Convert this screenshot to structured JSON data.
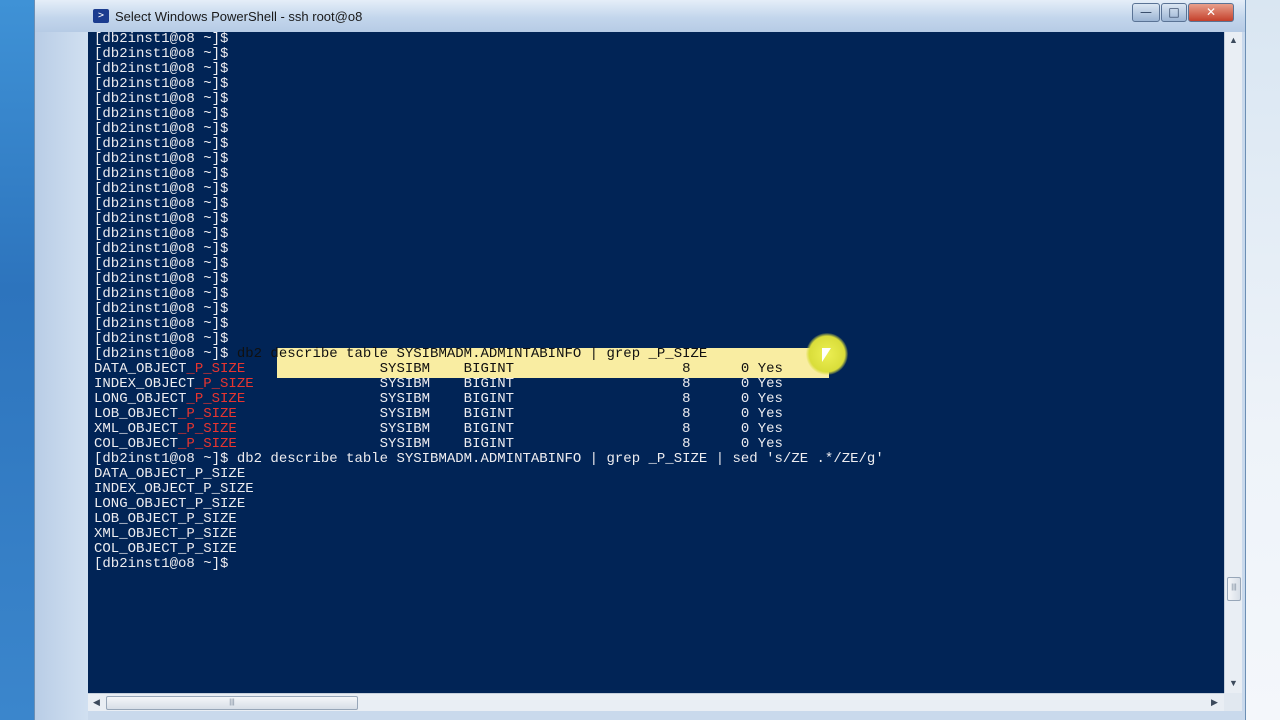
{
  "window": {
    "title": "Select Windows PowerShell - ssh  root@o8",
    "icon": "powershell-icon",
    "controls": {
      "minimize": "—",
      "maximize": "□",
      "close": "✕"
    }
  },
  "terminal": {
    "colors": {
      "background": "#012456",
      "text": "#eeedf0",
      "highlight": "#e8352f",
      "selection": "#f9eda2"
    },
    "lines": [
      [
        {
          "t": "[db2inst1@o8 ~]$"
        }
      ],
      [
        {
          "t": "[db2inst1@o8 ~]$"
        }
      ],
      [
        {
          "t": "[db2inst1@o8 ~]$"
        }
      ],
      [
        {
          "t": "[db2inst1@o8 ~]$"
        }
      ],
      [
        {
          "t": "[db2inst1@o8 ~]$"
        }
      ],
      [
        {
          "t": "[db2inst1@o8 ~]$"
        }
      ],
      [
        {
          "t": "[db2inst1@o8 ~]$"
        }
      ],
      [
        {
          "t": "[db2inst1@o8 ~]$"
        }
      ],
      [
        {
          "t": "[db2inst1@o8 ~]$"
        }
      ],
      [
        {
          "t": "[db2inst1@o8 ~]$"
        }
      ],
      [
        {
          "t": "[db2inst1@o8 ~]$"
        }
      ],
      [
        {
          "t": "[db2inst1@o8 ~]$"
        }
      ],
      [
        {
          "t": "[db2inst1@o8 ~]$"
        }
      ],
      [
        {
          "t": "[db2inst1@o8 ~]$"
        }
      ],
      [
        {
          "t": "[db2inst1@o8 ~]$"
        }
      ],
      [
        {
          "t": "[db2inst1@o8 ~]$"
        }
      ],
      [
        {
          "t": "[db2inst1@o8 ~]$"
        }
      ],
      [
        {
          "t": "[db2inst1@o8 ~]$"
        }
      ],
      [
        {
          "t": "[db2inst1@o8 ~]$"
        }
      ],
      [
        {
          "t": "[db2inst1@o8 ~]$"
        }
      ],
      [
        {
          "t": "[db2inst1@o8 ~]$"
        }
      ],
      [
        {
          "t": "[db2inst1@o8 ~]$ "
        },
        {
          "t": "db2 describe table SYSIBMADM.ADMINTABINFO | grep _P_SIZE",
          "c": "hl"
        }
      ],
      [
        {
          "t": "DATA_OBJECT"
        },
        {
          "t": "_P_SIZE",
          "c": "red"
        },
        {
          "t": "                SYSIBM    BIGINT                    8      0 Yes",
          "c": "hl"
        }
      ],
      [
        {
          "t": "INDEX_OBJECT"
        },
        {
          "t": "_P_SIZE",
          "c": "red"
        },
        {
          "t": "               SYSIBM    BIGINT                    8      0 Yes"
        }
      ],
      [
        {
          "t": "LONG_OBJECT"
        },
        {
          "t": "_P_SIZE",
          "c": "red"
        },
        {
          "t": "                SYSIBM    BIGINT                    8      0 Yes"
        }
      ],
      [
        {
          "t": "LOB_OBJECT"
        },
        {
          "t": "_P_SIZE",
          "c": "red"
        },
        {
          "t": "                 SYSIBM    BIGINT                    8      0 Yes"
        }
      ],
      [
        {
          "t": "XML_OBJECT"
        },
        {
          "t": "_P_SIZE",
          "c": "red"
        },
        {
          "t": "                 SYSIBM    BIGINT                    8      0 Yes"
        }
      ],
      [
        {
          "t": "COL_OBJECT"
        },
        {
          "t": "_P_SIZE",
          "c": "red"
        },
        {
          "t": "                 SYSIBM    BIGINT                    8      0 Yes"
        }
      ],
      [
        {
          "t": "[db2inst1@o8 ~]$ db2 describe table SYSIBMADM.ADMINTABINFO | grep _P_SIZE | sed 's/ZE .*/ZE/g'"
        }
      ],
      [
        {
          "t": "DATA_OBJECT_P_SIZE"
        }
      ],
      [
        {
          "t": "INDEX_OBJECT_P_SIZE"
        }
      ],
      [
        {
          "t": "LONG_OBJECT_P_SIZE"
        }
      ],
      [
        {
          "t": "LOB_OBJECT_P_SIZE"
        }
      ],
      [
        {
          "t": "XML_OBJECT_P_SIZE"
        }
      ],
      [
        {
          "t": "COL_OBJECT_P_SIZE"
        }
      ],
      [
        {
          "t": "[db2inst1@o8 ~]$"
        }
      ]
    ]
  },
  "scrollbars": {
    "up_arrow": "▲",
    "down_arrow": "▼",
    "left_arrow": "◀",
    "right_arrow": "▶",
    "grip": "|||"
  }
}
